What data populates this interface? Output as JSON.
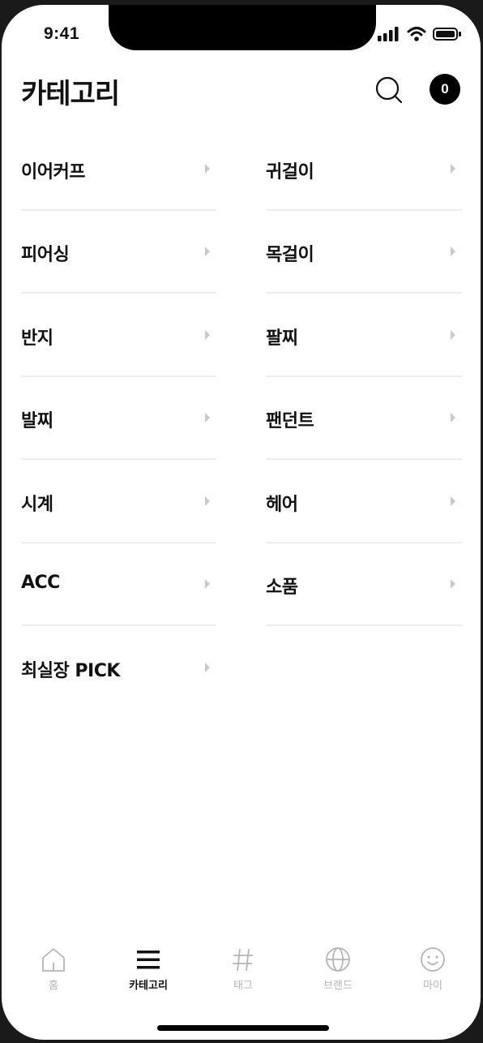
{
  "status_bar": {
    "time": "9:41"
  },
  "header": {
    "title": "카테고리",
    "cart_count": "0"
  },
  "categories": [
    {
      "label": "이어커프"
    },
    {
      "label": "귀걸이"
    },
    {
      "label": "피어싱"
    },
    {
      "label": "목걸이"
    },
    {
      "label": "반지"
    },
    {
      "label": "팔찌"
    },
    {
      "label": "발찌"
    },
    {
      "label": "팬던트"
    },
    {
      "label": "시계"
    },
    {
      "label": "헤어"
    },
    {
      "label": "ACC"
    },
    {
      "label": "소품"
    },
    {
      "label": "최실장 PICK"
    }
  ],
  "tab_bar": {
    "tabs": [
      {
        "label": "홈",
        "icon": "home-icon"
      },
      {
        "label": "카테고리",
        "icon": "menu-icon"
      },
      {
        "label": "태그",
        "icon": "hashtag-icon"
      },
      {
        "label": "브랜드",
        "icon": "globe-icon"
      },
      {
        "label": "마이",
        "icon": "smile-icon"
      }
    ],
    "active": "카테고리"
  },
  "colors": {
    "active": "#111111",
    "inactive": "#b5b5b5",
    "divider": "#ededed"
  }
}
